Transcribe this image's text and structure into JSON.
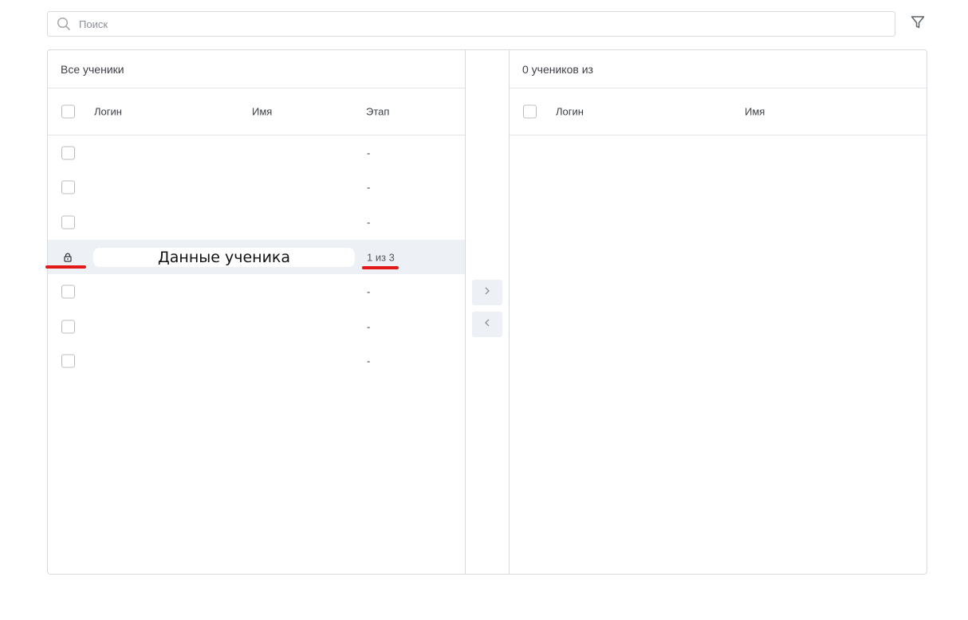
{
  "search": {
    "placeholder": "Поиск",
    "value": ""
  },
  "left_panel": {
    "title": "Все ученики",
    "columns": {
      "login": "Логин",
      "name": "Имя",
      "stage": "Этап"
    },
    "rows": [
      {
        "stage": "-"
      },
      {
        "stage": "-"
      },
      {
        "stage": "-"
      },
      {
        "locked": true,
        "name_label": "Данные ученика",
        "stage": "1 из 3"
      },
      {
        "stage": "-"
      },
      {
        "stage": "-"
      },
      {
        "stage": "-"
      }
    ]
  },
  "transfer": {
    "move_right_icon": "chevron-right-icon",
    "move_left_icon": "chevron-left-icon"
  },
  "right_panel": {
    "title": "0 учеников из",
    "columns": {
      "login": "Логин",
      "name": "Имя"
    }
  },
  "colors": {
    "annotation_red": "#e11919",
    "locked_row_bg": "#edf0f4",
    "border": "#d7dade"
  }
}
